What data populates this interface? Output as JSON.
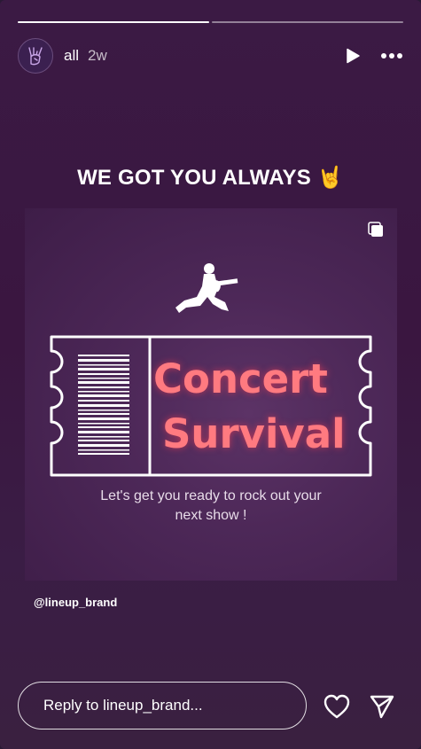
{
  "story": {
    "username": "all",
    "time_ago": "2w",
    "progress": {
      "segments": 2,
      "current": 1
    }
  },
  "post": {
    "headline": "WE GOT YOU ALWAYS",
    "headline_emoji": "🤘",
    "title_line1": "Concert",
    "title_line2": "Survival",
    "tagline_line1": "Let's get you ready to rock out your",
    "tagline_line2": "next show !",
    "handle": "@lineup_brand"
  },
  "reply": {
    "placeholder": "Reply to lineup_brand..."
  },
  "icons": {
    "play": "play-icon",
    "more": "more-icon",
    "multi": "multi-image-icon",
    "heart": "heart-icon",
    "send": "send-icon"
  },
  "colors": {
    "accent_title": "#ff7a80",
    "background": "#3a1640"
  }
}
